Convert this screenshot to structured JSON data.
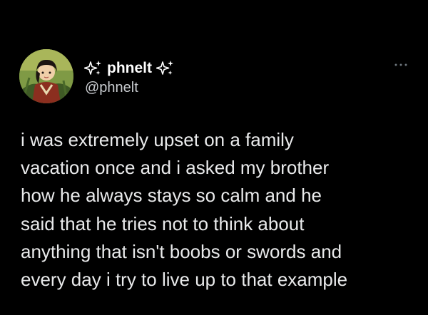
{
  "colors": {
    "background": "#000000",
    "text": "#e9eaeb",
    "handle": "#c9ccd0",
    "avatar_bg": "#6f8a3a"
  },
  "header": {
    "left_icon": "sparkles-icon",
    "display_name": "phnelt",
    "right_icon": "sparkles-icon",
    "handle": "@phnelt",
    "more_icon": "more-options-icon"
  },
  "tweet": {
    "lines": [
      "i was extremely upset on a family",
      "vacation once and i asked my brother",
      "how he always stays so calm and he",
      "said that he tries not to think about",
      "anything that isn't boobs or swords and",
      "every day i try to live up to that example"
    ]
  }
}
